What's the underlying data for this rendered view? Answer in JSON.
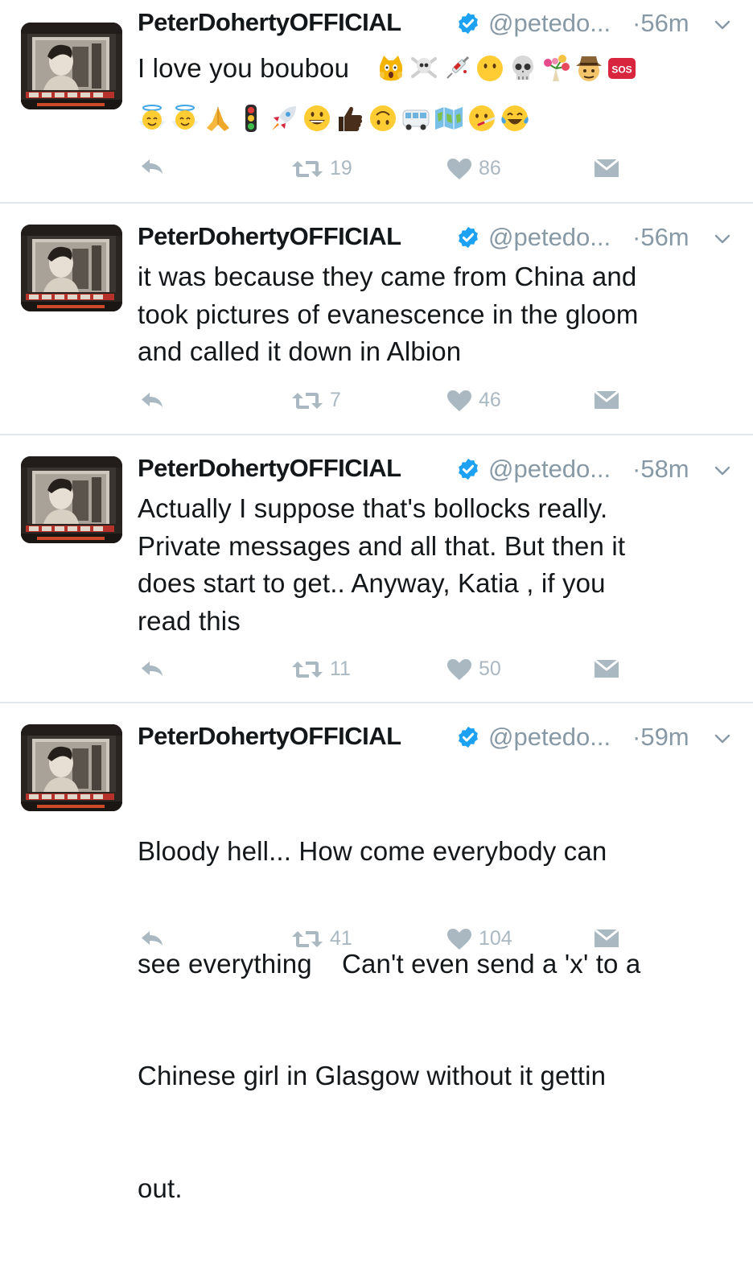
{
  "accent_color": "#1da1f2",
  "muted_color": "#8899a6",
  "icon_color": "#aab8c2",
  "tweets": [
    {
      "name": "PeterDohertyOFFICIAL",
      "handle": "@petedo...",
      "time": "·56m",
      "text": "I love you boubou",
      "emojis": [
        "scream-cat-emoji",
        "skull-crossbones-emoji",
        "syringe-emoji",
        "no-mouth-face-emoji",
        "skull-emoji",
        "bouquet-emoji",
        "detective-emoji",
        "sos-emoji",
        "halo-angel-emoji",
        "halo-angel-emoji",
        "folded-hands-emoji",
        "traffic-light-emoji",
        "rocket-emoji",
        "grinning-face-emoji",
        "thumbs-up-emoji",
        "upside-down-face-emoji",
        "minibus-emoji",
        "map-emoji",
        "face-with-thermometer-emoji",
        "tears-of-joy-emoji"
      ],
      "retweets": "19",
      "likes": "86"
    },
    {
      "name": "PeterDohertyOFFICIAL",
      "handle": "@petedo...",
      "time": "·56m",
      "lines": [
        "it was because they came from China and",
        "took pictures of evanescence in the gloom",
        "and called it down in Albion"
      ],
      "retweets": "7",
      "likes": "46"
    },
    {
      "name": "PeterDohertyOFFICIAL",
      "handle": "@petedo...",
      "time": "·58m",
      "lines": [
        "Actually I suppose that's bollocks really.",
        "Private messages and all that. But then it",
        "does start to get.. Anyway, Katia , if you",
        "read this"
      ],
      "retweets": "11",
      "likes": "50"
    },
    {
      "name": "PeterDohertyOFFICIAL",
      "handle": "@petedo...",
      "time": "·59m",
      "lines": [
        "Bloody hell... How come everybody can",
        "see everything    Can't even send a 'x' to a",
        "Chinese girl in Glasgow without it gettin",
        "out."
      ],
      "retweets": "41",
      "likes": "104"
    }
  ]
}
